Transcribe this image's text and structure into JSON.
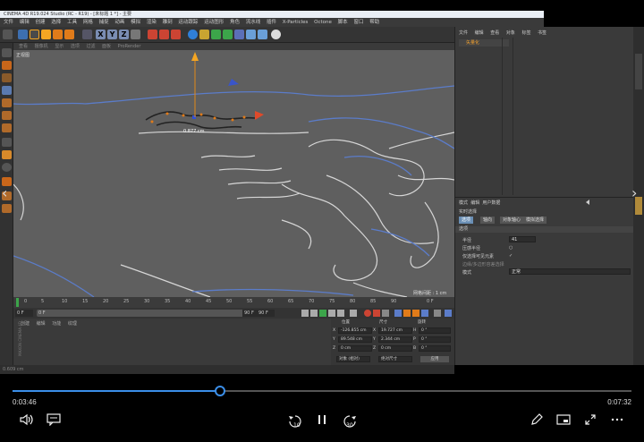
{
  "app": {
    "title": "CINEMA 4D R19.024 Studio (RC - R19) - [未标题 1 *] - 主要",
    "menus": [
      "文件",
      "编辑",
      "创建",
      "选择",
      "工具",
      "网格",
      "捕捉",
      "动画",
      "模拟",
      "渲染",
      "雕刻",
      "运动跟踪",
      "运动图形",
      "角色",
      "流水线",
      "插件",
      "X-Particles",
      "Octone",
      "脚本",
      "窗口",
      "帮助"
    ],
    "toolbar_icons": [
      "undo-icon",
      "move-icon",
      "select-icon",
      "rotate-icon",
      "scale-icon",
      "x-axis-icon",
      "y-axis-icon",
      "z-axis-icon",
      "world-icon",
      "render-view-icon",
      "render-icon",
      "render-settings-icon",
      "cube-icon",
      "pen-icon",
      "subdivide-icon",
      "array-icon",
      "deformer-icon",
      "scene-icon",
      "camera-icon",
      "light-icon"
    ],
    "axis_labels": [
      "X",
      "Y",
      "Z"
    ]
  },
  "viewport": {
    "menu": [
      "查看",
      "摄像机",
      "显示",
      "选项",
      "过滤",
      "面板",
      "ProRender"
    ],
    "label": "正视图",
    "measure": "0.877 cm",
    "grid_info": "网格间距 : 1 cm"
  },
  "timeline": {
    "ticks": [
      "0",
      "5",
      "10",
      "15",
      "20",
      "25",
      "30",
      "35",
      "40",
      "45",
      "50",
      "55",
      "60",
      "65",
      "70",
      "75",
      "80",
      "85",
      "90"
    ],
    "end_frame": "0 F",
    "start": "0 F",
    "current": "0 F",
    "range_end": "90 F",
    "max": "90 F"
  },
  "material": {
    "menu": [
      "创建",
      "编辑",
      "功能",
      "纹理"
    ],
    "watermark": "MAXON CINEMA 4D"
  },
  "coords": {
    "headers": [
      "位置",
      "尺寸",
      "旋转"
    ],
    "rows": [
      {
        "axis": "X",
        "pos": "-126.855 cm",
        "size": "19.727 cm",
        "rot_label": "H",
        "rot": "0 °"
      },
      {
        "axis": "Y",
        "pos": "89.548 cm",
        "size": "2.344 cm",
        "rot_label": "P",
        "rot": "0 °"
      },
      {
        "axis": "Z",
        "pos": "0 cm",
        "size": "0 cm",
        "rot_label": "B",
        "rot": "0 °"
      }
    ],
    "mode": "对象 (相对)",
    "size_mode": "绝对尺寸",
    "apply": "应用"
  },
  "status": {
    "text": "0.609 cm"
  },
  "objects": {
    "menu": [
      "文件",
      "编辑",
      "查看",
      "对象",
      "标签",
      "书签"
    ],
    "item": "矢量化"
  },
  "attributes": {
    "menu": [
      "模式",
      "编辑",
      "用户数据"
    ],
    "title": "实时选择",
    "tabs": [
      "选项",
      "轴向",
      "对象轴心",
      "模拟选择"
    ],
    "section": "选项",
    "rows": [
      {
        "label": "半径",
        "value": "41"
      },
      {
        "label": "压感半径",
        "value": "○"
      },
      {
        "label": "仅选择可见元素",
        "value": "✓"
      },
      {
        "label": "边缘/多边形容差选择",
        "value": ""
      },
      {
        "label": "模式",
        "value": "正常"
      }
    ]
  },
  "player": {
    "current_time": "0:03:46",
    "duration": "0:07:32",
    "progress": 0.335,
    "rewind_label": "10",
    "forward_label": "30",
    "accent": "#3b8ee8"
  }
}
